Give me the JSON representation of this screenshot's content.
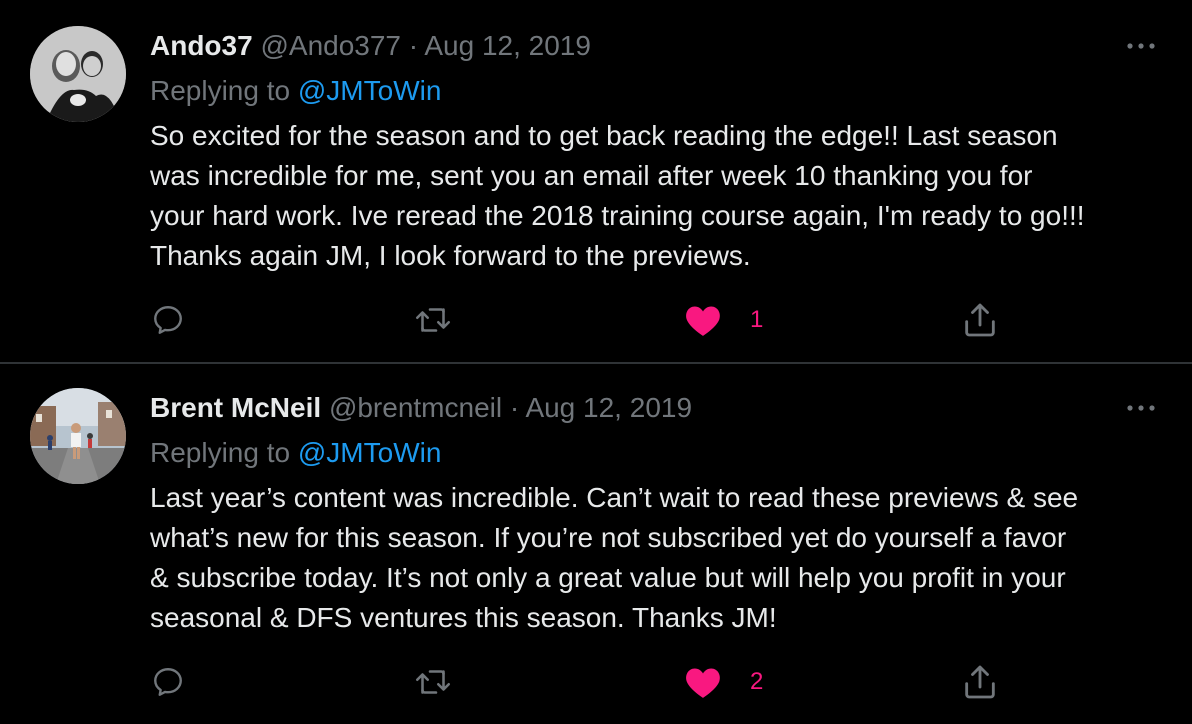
{
  "tweets": [
    {
      "display_name": "Ando37",
      "handle": "@Ando377",
      "separator": "·",
      "date": "Aug 12, 2019",
      "replying_prefix": "Replying to",
      "replying_to": "@JMToWin",
      "body_lines": [
        "So excited for the season and to get back reading the edge!! Last season",
        "was incredible for me, sent you an email after week 10 thanking you for",
        "your hard work. Ive reread the 2018 training course again, I'm ready to go!!!",
        "Thanks again JM, I look forward to the previews."
      ],
      "like_count": "1",
      "liked": true
    },
    {
      "display_name": "Brent McNeil",
      "handle": "@brentmcneil",
      "separator": "·",
      "date": "Aug 12, 2019",
      "replying_prefix": "Replying to",
      "replying_to": "@JMToWin",
      "body_lines": [
        "Last year’s content was incredible. Can’t wait to read these previews & see",
        "what’s new for this season. If you’re not subscribed yet do yourself a favor",
        "& subscribe today. It’s not only a great value but will help you profit in your",
        "seasonal & DFS ventures this season. Thanks JM!"
      ],
      "like_count": "2",
      "liked": true
    }
  ],
  "icons": {
    "reply": "reply-icon",
    "retweet": "retweet-icon",
    "like": "heart-icon",
    "share": "share-icon",
    "more": "more-icon"
  },
  "colors": {
    "background": "#000000",
    "text_primary": "#e7e9ea",
    "text_secondary": "#71767b",
    "mention": "#1d9bf0",
    "like": "#f91880",
    "divider": "#2f3336"
  }
}
